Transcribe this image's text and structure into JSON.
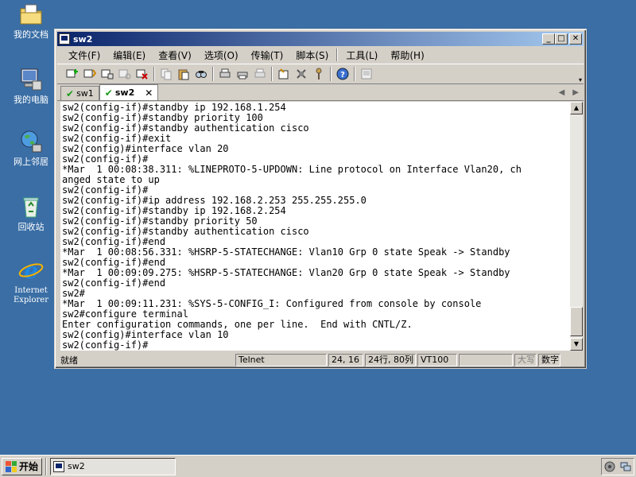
{
  "desktop": {
    "icons": [
      {
        "label": "我的文档"
      },
      {
        "label": "我的电脑"
      },
      {
        "label": "网上邻居"
      },
      {
        "label": "回收站"
      },
      {
        "label_line1": "Internet",
        "label_line2": "Explorer"
      }
    ]
  },
  "window": {
    "title": "sw2",
    "min_glyph": "_",
    "max_glyph": "□",
    "close_glyph": "✕"
  },
  "menu": [
    "文件(F)",
    "编辑(E)",
    "查看(V)",
    "选项(O)",
    "传输(T)",
    "脚本(S)",
    "工具(L)",
    "帮助(H)"
  ],
  "tabs": [
    {
      "label": "sw1",
      "active": false
    },
    {
      "label": "sw2",
      "active": true,
      "close": "✕"
    }
  ],
  "tab_nav": {
    "prev": "◀",
    "next": "▶"
  },
  "terminal": {
    "lines": [
      "sw2(config-if)#standby ip 192.168.1.254",
      "sw2(config-if)#standby priority 100",
      "sw2(config-if)#standby authentication cisco",
      "sw2(config-if)#exit",
      "sw2(config)#interface vlan 20",
      "sw2(config-if)#",
      "*Mar  1 00:08:38.311: %LINEPROTO-5-UPDOWN: Line protocol on Interface Vlan20, ch",
      "anged state to up",
      "sw2(config-if)#",
      "sw2(config-if)#ip address 192.168.2.253 255.255.255.0",
      "sw2(config-if)#standby ip 192.168.2.254",
      "sw2(config-if)#standby priority 50",
      "sw2(config-if)#standby authentication cisco",
      "sw2(config-if)#end",
      "*Mar  1 00:08:56.331: %HSRP-5-STATECHANGE: Vlan10 Grp 0 state Speak -> Standby",
      "sw2(config-if)#end",
      "*Mar  1 00:09:09.275: %HSRP-5-STATECHANGE: Vlan20 Grp 0 state Speak -> Standby",
      "sw2(config-if)#end",
      "sw2#",
      "*Mar  1 00:09:11.231: %SYS-5-CONFIG_I: Configured from console by console",
      "sw2#configure terminal",
      "Enter configuration commands, one per line.  End with CNTL/Z.",
      "sw2(config)#interface vlan 10",
      "sw2(config-if)#"
    ]
  },
  "scrollbar": {
    "up": "▲",
    "down": "▼"
  },
  "status": {
    "ready": "就绪",
    "protocol": "Telnet",
    "cursor": "24, 16",
    "size": "24行, 80列",
    "emulation": "VT100",
    "caps": "大写",
    "num": "数字"
  },
  "taskbar": {
    "start_label": "开始",
    "task_label": "sw2"
  }
}
